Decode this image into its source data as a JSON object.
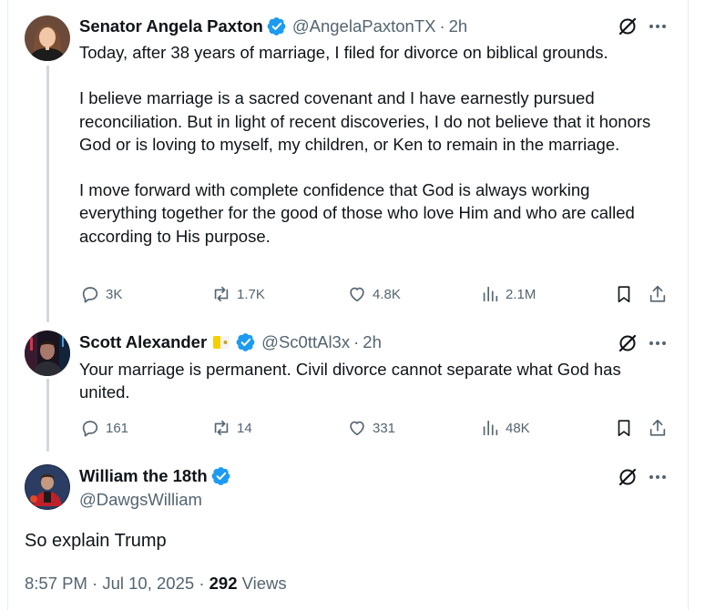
{
  "tweets": [
    {
      "name": "Senator Angela Paxton",
      "handle": "@AngelaPaxtonTX",
      "time": "2h",
      "text": "Today, after 38 years of marriage, I filed for divorce on biblical grounds.\n\nI believe marriage is a sacred covenant and I have earnestly pursued reconciliation. But in light of recent discoveries, I do not believe that it honors God or is loving to myself, my children, or Ken to remain in the marriage.\n\nI move forward with complete confidence that God is always working everything together for the good of those who love Him and who are called according to His purpose.",
      "replies": "3K",
      "reposts": "1.7K",
      "likes": "4.8K",
      "views": "2.1M"
    },
    {
      "name": "Scott Alexander",
      "handle": "@Sc0ttAl3x",
      "time": "2h",
      "text": "Your marriage is permanent. Civil divorce cannot separate what God has\nunited.",
      "replies": "161",
      "reposts": "14",
      "likes": "331",
      "views": "48K"
    }
  ],
  "main_tweet": {
    "name": "William the 18th",
    "handle": "@DawgsWilliam",
    "text": "So explain Trump",
    "time": "8:57 PM",
    "date": "Jul 10, 2025",
    "views_count": "292",
    "views_label": "Views"
  },
  "separator": "·",
  "icons": {
    "verified": "verified-badge-icon",
    "grok": "grok-icon",
    "more": "more-icon",
    "reply": "reply-icon",
    "repost": "repost-icon",
    "like": "like-icon",
    "views": "views-icon",
    "bookmark": "bookmark-icon",
    "share": "share-icon",
    "flag": "vatican-flag-icon"
  },
  "colors": {
    "verified": "#1d9bf0",
    "text": "#0f1419",
    "secondary": "#536471",
    "thread_line": "#cfd9de"
  }
}
